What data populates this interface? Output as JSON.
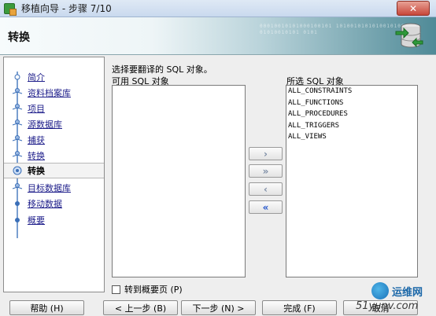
{
  "window": {
    "title": "移植向导 - 步骤 7/10",
    "close_label": "✕"
  },
  "header": {
    "title": "转换",
    "binary_text": "00010010101000100101 10100101010100101001 01010010101 0101"
  },
  "nav": {
    "items": [
      {
        "label": "简介",
        "active": false
      },
      {
        "label": "资料档案库",
        "active": false
      },
      {
        "label": "项目",
        "active": false
      },
      {
        "label": "源数据库",
        "active": false
      },
      {
        "label": "捕获",
        "active": false
      },
      {
        "label": "转换",
        "active": false
      },
      {
        "label": "转换",
        "active": true
      },
      {
        "label": "目标数据库",
        "active": false
      },
      {
        "label": "移动数据",
        "active": false
      },
      {
        "label": "概要",
        "active": false
      }
    ]
  },
  "main": {
    "instruction": "选择要翻译的 SQL 对象。",
    "available_label": "可用 SQL 对象",
    "selected_label": "所选 SQL 对象",
    "available_items": [],
    "selected_items": [
      "ALL_CONSTRAINTS",
      "ALL_FUNCTIONS",
      "ALL_PROCEDURES",
      "ALL_TRIGGERS",
      "ALL_VIEWS"
    ],
    "move_buttons": {
      "add_one": "›",
      "add_all": "»",
      "remove_one": "‹",
      "remove_all": "«"
    },
    "checkbox_label": "转到概要页 (P)"
  },
  "footer": {
    "help": "帮助 (H)",
    "back": "< 上一步 (B)",
    "next": "下一步 (N) >",
    "finish": "完成 (F)",
    "cancel": "取消"
  },
  "watermark": {
    "name": "运维网",
    "url": "51yunv.com"
  },
  "colors": {
    "link": "#1d1d8a",
    "accent": "#2255cc",
    "header_dark": "#4f8a97"
  }
}
